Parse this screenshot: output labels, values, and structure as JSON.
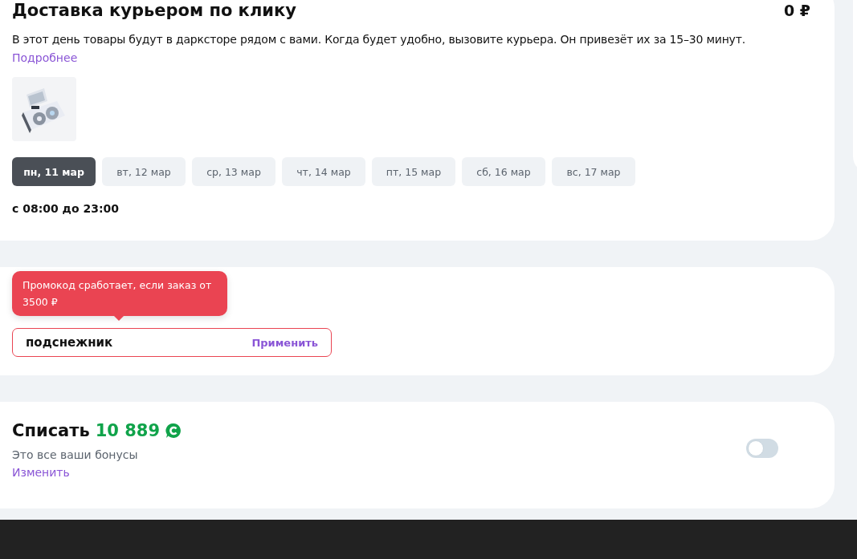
{
  "delivery": {
    "title": "Доставка курьером по клику",
    "price": "0 ₽",
    "description": "В этот день товары будут в дарксторе рядом с вами. Когда будет удобно, вызовите курьера. Он привезёт их за 15–30 минут.",
    "more_link": "Подробнее",
    "days": [
      {
        "label": "пн, 11 мар",
        "selected": true
      },
      {
        "label": "вт, 12 мар",
        "selected": false
      },
      {
        "label": "ср, 13 мар",
        "selected": false
      },
      {
        "label": "чт, 14 мар",
        "selected": false
      },
      {
        "label": "пт, 15 мар",
        "selected": false
      },
      {
        "label": "сб, 16 мар",
        "selected": false
      },
      {
        "label": "вс, 17 мар",
        "selected": false
      }
    ],
    "hours": "с 08:00 до 23:00"
  },
  "promo": {
    "tooltip": "Промокод сработает, если заказ от 3500 ₽",
    "value": "подснежник",
    "apply": "Применить",
    "error": true
  },
  "bonus": {
    "title": "Списать",
    "amount": "10 889",
    "note": "Это все ваши бонусы",
    "change_link": "Изменить",
    "on": false
  }
}
